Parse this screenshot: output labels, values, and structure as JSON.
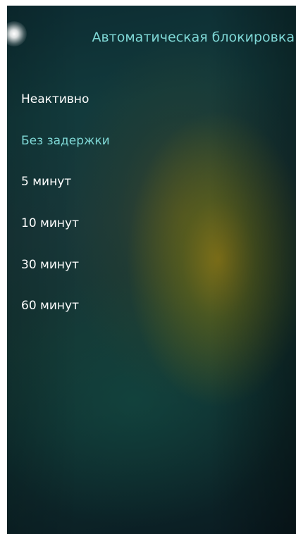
{
  "header": {
    "title": "Автоматическая блокировка"
  },
  "options": [
    {
      "label": "Неактивно",
      "selected": false
    },
    {
      "label": "Без задержки",
      "selected": true
    },
    {
      "label": "5 минут",
      "selected": false
    },
    {
      "label": "10 минут",
      "selected": false
    },
    {
      "label": "30 минут",
      "selected": false
    },
    {
      "label": "60 минут",
      "selected": false
    }
  ],
  "colors": {
    "highlight": "#7fd8d6",
    "text": "#ffffff"
  }
}
